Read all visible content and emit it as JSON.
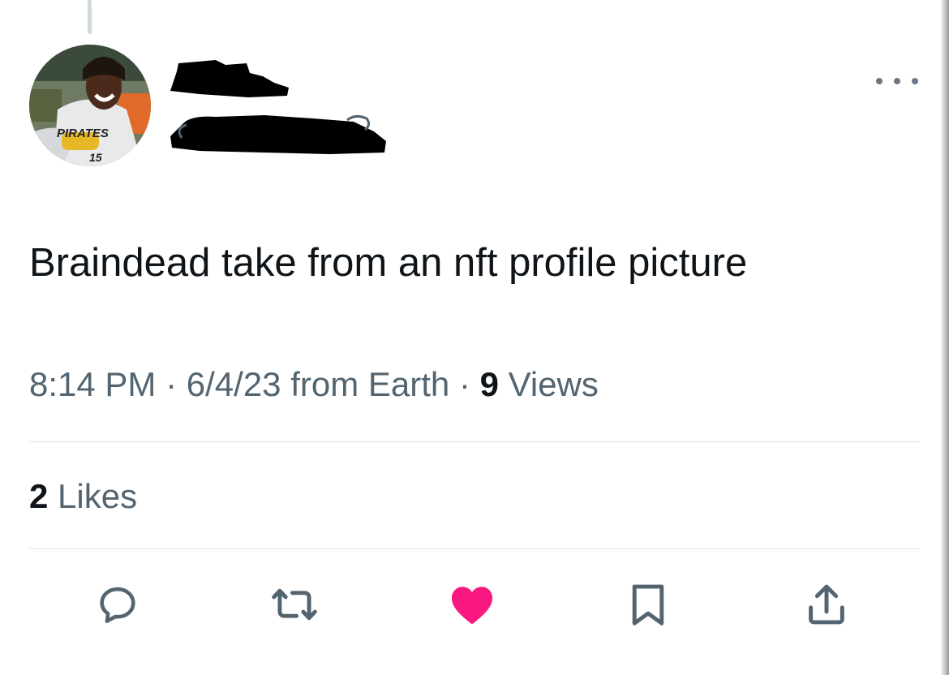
{
  "tweet": {
    "text": "Braindead take from an nft profile picture",
    "time": "8:14 PM",
    "separator": "·",
    "date": "6/4/23",
    "source": "from Earth",
    "views_count": "9",
    "views_label": "Views",
    "likes_count": "2",
    "likes_label": "Likes",
    "avatar_jersey_text": "PIRATES",
    "avatar_jersey_number": "15"
  },
  "actions": [
    {
      "name": "reply",
      "icon": "reply-icon"
    },
    {
      "name": "retweet",
      "icon": "retweet-icon"
    },
    {
      "name": "like",
      "icon": "heart-icon",
      "active": true,
      "color": "#f91880"
    },
    {
      "name": "bookmark",
      "icon": "bookmark-icon"
    },
    {
      "name": "share",
      "icon": "share-icon"
    }
  ],
  "colors": {
    "text_primary": "#0f1419",
    "text_secondary": "#536471",
    "icon": "#536471",
    "like_active": "#f91880",
    "divider": "#dfe3e7"
  }
}
